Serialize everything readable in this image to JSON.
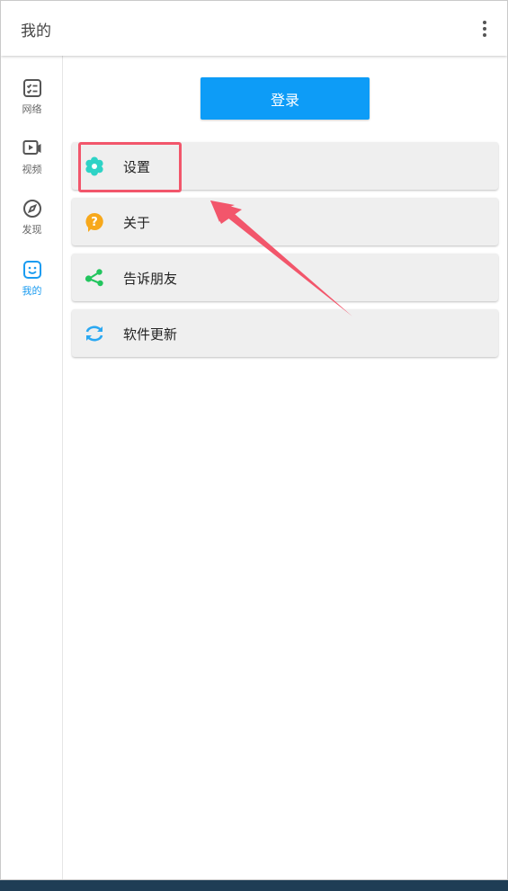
{
  "appbar": {
    "title": "我的",
    "more_icon": "more-vert-icon"
  },
  "sidebar": {
    "items": [
      {
        "label": "网络",
        "icon": "checklist-icon",
        "active": false
      },
      {
        "label": "视频",
        "icon": "video-icon",
        "active": false
      },
      {
        "label": "发现",
        "icon": "compass-icon",
        "active": false
      },
      {
        "label": "我的",
        "icon": "smile-icon",
        "active": true
      }
    ]
  },
  "main": {
    "login_label": "登录",
    "menu": [
      {
        "label": "设置",
        "icon": "gear-icon"
      },
      {
        "label": "关于",
        "icon": "help-icon"
      },
      {
        "label": "告诉朋友",
        "icon": "share-icon"
      },
      {
        "label": "软件更新",
        "icon": "refresh-icon"
      }
    ]
  },
  "colors": {
    "accent": "#1a9bf0",
    "login_button": "#0d9cf7",
    "annotation": "#f2566b",
    "settings_icon": "#2ed3c6",
    "about_icon": "#f7a81b",
    "share_icon": "#22c55e",
    "update_icon": "#2aa8f2"
  }
}
